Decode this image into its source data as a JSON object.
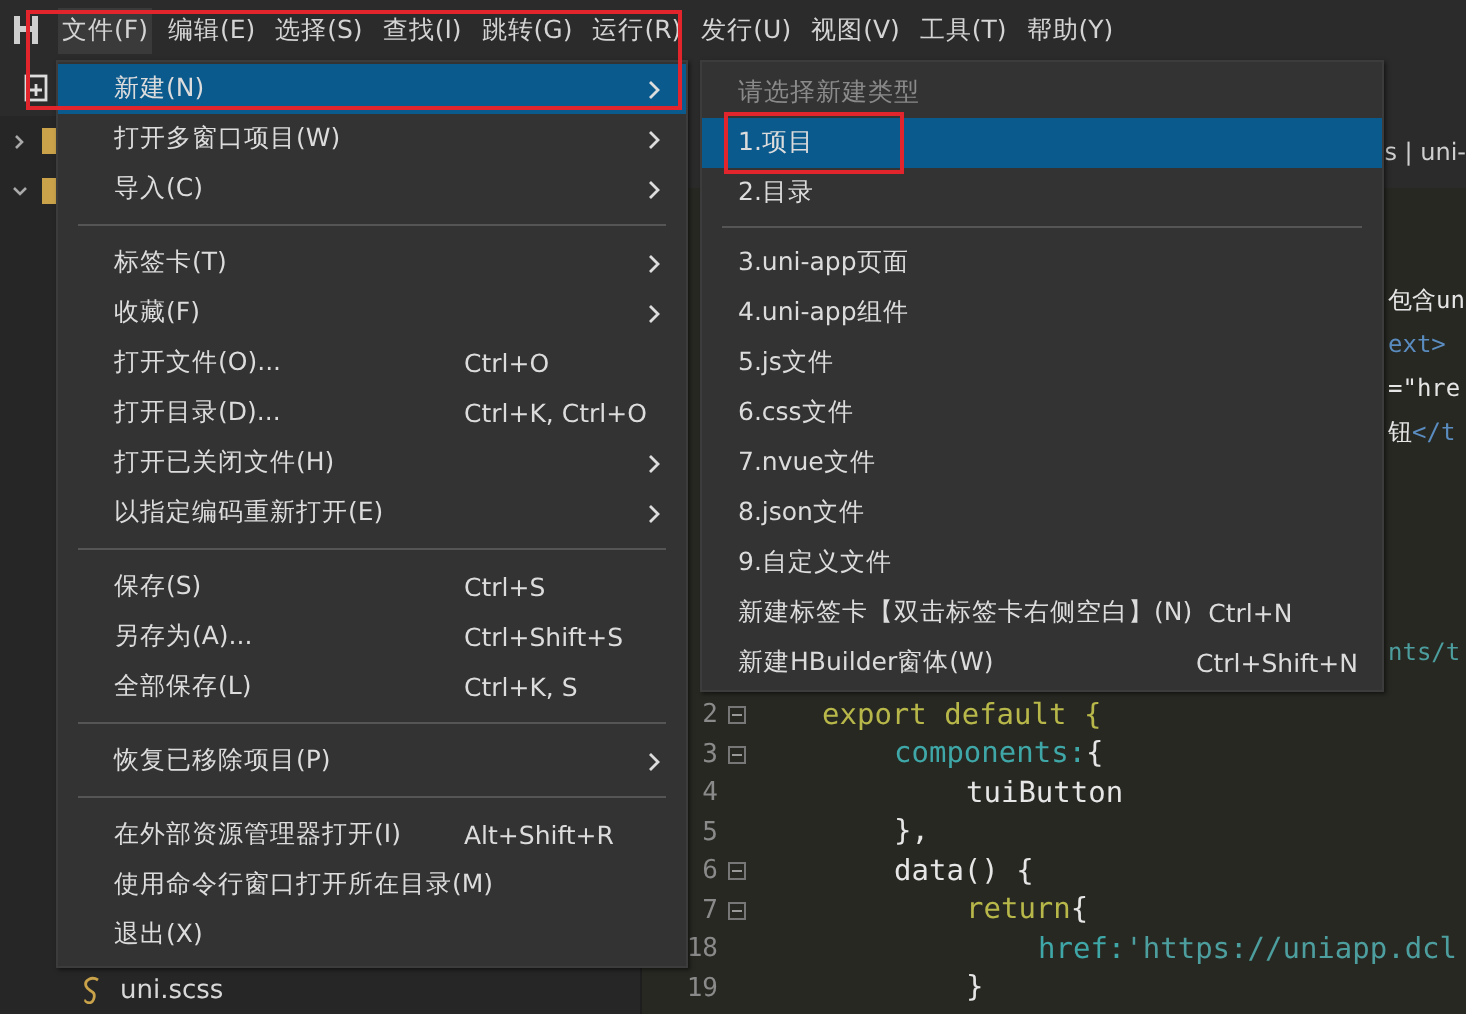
{
  "menubar": [
    {
      "label": "文件(F)",
      "selected": true
    },
    {
      "label": "编辑(E)",
      "selected": false
    },
    {
      "label": "选择(S)",
      "selected": false
    },
    {
      "label": "查找(I)",
      "selected": false
    },
    {
      "label": "跳转(G)",
      "selected": false
    },
    {
      "label": "运行(R)",
      "selected": false
    },
    {
      "label": "发行(U)",
      "selected": false
    },
    {
      "label": "视图(V)",
      "selected": false
    },
    {
      "label": "工具(T)",
      "selected": false
    },
    {
      "label": "帮助(Y)",
      "selected": false
    }
  ],
  "file_menu": {
    "items": [
      {
        "kind": "item",
        "label": "新建(N)",
        "submenu": true,
        "selected": true
      },
      {
        "kind": "item",
        "label": "打开多窗口项目(W)",
        "submenu": true,
        "selected": false
      },
      {
        "kind": "item",
        "label": "导入(C)",
        "submenu": true,
        "selected": false
      },
      {
        "kind": "separator"
      },
      {
        "kind": "item",
        "label": "标签卡(T)",
        "submenu": true,
        "selected": false
      },
      {
        "kind": "item",
        "label": "收藏(F)",
        "submenu": true,
        "selected": false
      },
      {
        "kind": "item",
        "label": "打开文件(O)...",
        "shortcut": "Ctrl+O",
        "submenu": false,
        "selected": false
      },
      {
        "kind": "item",
        "label": "打开目录(D)...",
        "shortcut": "Ctrl+K, Ctrl+O",
        "submenu": false,
        "selected": false
      },
      {
        "kind": "item",
        "label": "打开已关闭文件(H)",
        "submenu": true,
        "selected": false
      },
      {
        "kind": "item",
        "label": "以指定编码重新打开(E)",
        "submenu": true,
        "selected": false
      },
      {
        "kind": "separator"
      },
      {
        "kind": "item",
        "label": "保存(S)",
        "shortcut": "Ctrl+S",
        "submenu": false,
        "selected": false
      },
      {
        "kind": "item",
        "label": "另存为(A)...",
        "shortcut": "Ctrl+Shift+S",
        "submenu": false,
        "selected": false
      },
      {
        "kind": "item",
        "label": "全部保存(L)",
        "shortcut": "Ctrl+K, S",
        "submenu": false,
        "selected": false
      },
      {
        "kind": "separator"
      },
      {
        "kind": "item",
        "label": "恢复已移除项目(P)",
        "submenu": true,
        "selected": false
      },
      {
        "kind": "separator"
      },
      {
        "kind": "item",
        "label": "在外部资源管理器打开(I)",
        "shortcut": "Alt+Shift+R",
        "submenu": false,
        "selected": false
      },
      {
        "kind": "item",
        "label": "使用命令行窗口打开所在目录(M)",
        "submenu": false,
        "selected": false
      },
      {
        "kind": "item",
        "label": "退出(X)",
        "submenu": false,
        "selected": false
      }
    ]
  },
  "new_submenu": {
    "items": [
      {
        "kind": "header",
        "label": "请选择新建类型"
      },
      {
        "kind": "item",
        "label": "1.项目",
        "selected": true,
        "outlined": true
      },
      {
        "kind": "item",
        "label": "2.目录",
        "selected": false,
        "outlined": false
      },
      {
        "kind": "separator"
      },
      {
        "kind": "item",
        "label": "3.uni-app页面",
        "selected": false,
        "outlined": false
      },
      {
        "kind": "item",
        "label": "4.uni-app组件",
        "selected": false,
        "outlined": false
      },
      {
        "kind": "item",
        "label": "5.js文件",
        "selected": false,
        "outlined": false
      },
      {
        "kind": "item",
        "label": "6.css文件",
        "selected": false,
        "outlined": false
      },
      {
        "kind": "item",
        "label": "7.nvue文件",
        "selected": false,
        "outlined": false
      },
      {
        "kind": "item",
        "label": "8.json文件",
        "selected": false,
        "outlined": false
      },
      {
        "kind": "item",
        "label": "9.自定义文件",
        "selected": false,
        "outlined": false
      },
      {
        "kind": "item",
        "label": "新建标签卡【双击标签卡右侧空白】(N)",
        "shortcut": "Ctrl+N",
        "selected": false,
        "outlined": false
      },
      {
        "kind": "item",
        "label": "新建HBuilder窗体(W)",
        "shortcut": "Ctrl+Shift+N",
        "selected": false,
        "outlined": false
      }
    ]
  },
  "sidebar": {
    "tree": [
      {
        "expanded": false
      },
      {
        "expanded": true
      }
    ],
    "file": "uni.scss"
  },
  "editor": {
    "tab_text": "s | uni-",
    "peek_lines": [
      [
        {
          "text": "包含un",
          "kind": "plain"
        }
      ],
      [
        {
          "text": "ext>",
          "kind": "tag"
        }
      ],
      [
        {
          "text": "=\"hre",
          "kind": "plain"
        }
      ],
      [
        {
          "text": "钮",
          "kind": "plain"
        },
        {
          "text": "</t",
          "kind": "tag"
        }
      ]
    ],
    "peek_lower": [
      {
        "text": "nts/t",
        "kind": "string"
      }
    ],
    "code": [
      {
        "number": "2",
        "fold": true,
        "tokens": [
          {
            "text": "export default {",
            "kind": "keyword"
          }
        ],
        "children": [
          {
            "number": "3",
            "fold": true,
            "tokens": [
              {
                "text": "components:",
                "kind": "prop"
              },
              {
                "text": " {",
                "kind": "plain"
              }
            ],
            "children": [
              {
                "number": "4",
                "fold": false,
                "tokens": [
                  {
                    "text": "tuiButton",
                    "kind": "plain"
                  }
                ]
              }
            ]
          },
          {
            "number": "5",
            "fold": false,
            "tokens": [
              {
                "text": "},",
                "kind": "plain"
              }
            ]
          },
          {
            "number": "6",
            "fold": true,
            "tokens": [
              {
                "text": "data() {",
                "kind": "plain"
              }
            ],
            "children": [
              {
                "number": "7",
                "fold": true,
                "tokens": [
                  {
                    "text": "return",
                    "kind": "keyword"
                  },
                  {
                    "text": " {",
                    "kind": "plain"
                  }
                ],
                "children": [
                  {
                    "number": "18",
                    "fold": false,
                    "tokens": [
                      {
                        "text": "href:",
                        "kind": "prop"
                      },
                      {
                        "text": " 'https://uniapp.dcl",
                        "kind": "string"
                      }
                    ]
                  }
                ]
              },
              {
                "number": "19",
                "fold": false,
                "tokens": [
                  {
                    "text": "}",
                    "kind": "plain"
                  }
                ]
              }
            ]
          }
        ]
      }
    ]
  }
}
